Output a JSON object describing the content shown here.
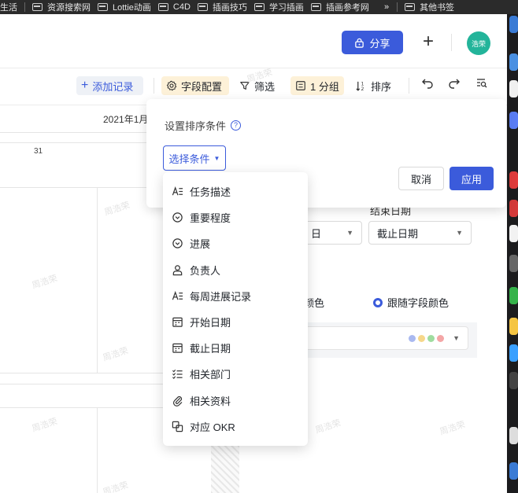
{
  "bookmarks": [
    {
      "label": "生活"
    },
    {
      "label": "资源搜索网"
    },
    {
      "label": "Lottie动画"
    },
    {
      "label": "C4D"
    },
    {
      "label": "插画技巧"
    },
    {
      "label": "学习插画"
    },
    {
      "label": "插画参考网"
    }
  ],
  "bookmarks_more": "»",
  "bookmarks_other": "其他书签",
  "header": {
    "share_label": "分享",
    "plus_label": "+",
    "avatar_text": "浩荣"
  },
  "toolbar": {
    "add_record": "添加记录",
    "field_config": "字段配置",
    "filter": "筛选",
    "group": "1 分组",
    "sort": "排序"
  },
  "calendar": {
    "month_header": "2021年1月",
    "day": "31"
  },
  "watermark": "周浩荣",
  "background_panel": {
    "end_date_label": "结束日期",
    "select_a_value": "日",
    "select_b_value": "截止日期",
    "radio_a_label": "颜色",
    "radio_b_label": "跟随字段颜色",
    "color_dots": [
      "#a9b9f0",
      "#f6d78a",
      "#9fdc9f",
      "#f4a6a6"
    ]
  },
  "sort_popover": {
    "title": "设置排序条件",
    "help": "?",
    "choose_label": "选择条件",
    "cancel_label": "取消",
    "apply_label": "应用"
  },
  "dropdown": {
    "items": [
      {
        "label": "任务描述",
        "icon": "text-icon"
      },
      {
        "label": "重要程度",
        "icon": "select-icon"
      },
      {
        "label": "进展",
        "icon": "select-icon"
      },
      {
        "label": "负责人",
        "icon": "person-icon"
      },
      {
        "label": "每周进展记录",
        "icon": "text-icon"
      },
      {
        "label": "开始日期",
        "icon": "calendar-icon"
      },
      {
        "label": "截止日期",
        "icon": "calendar-icon"
      },
      {
        "label": "相关部门",
        "icon": "checklist-icon"
      },
      {
        "label": "相关资料",
        "icon": "attachment-icon"
      },
      {
        "label": "对应 OKR",
        "icon": "link-icon"
      }
    ]
  },
  "colors": {
    "accent": "#3b5bdb",
    "highlight": "#fdf1d8",
    "avatar": "#23b49a"
  }
}
